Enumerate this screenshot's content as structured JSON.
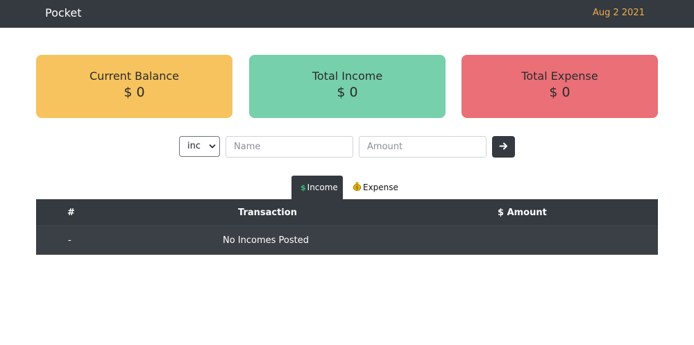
{
  "navbar": {
    "brand": "Pocket",
    "date": "Aug 2 2021",
    "date_color": "#f0ad4e"
  },
  "cards": {
    "balance": {
      "title": "Current Balance",
      "value": "$ 0",
      "color": "#f6c35e"
    },
    "income": {
      "title": "Total Income",
      "value": "$ 0",
      "color": "#76d0ab"
    },
    "expense": {
      "title": "Total Expense",
      "value": "$ 0",
      "color": "#ea6f77"
    }
  },
  "form": {
    "type_select": {
      "selected": "inc"
    },
    "name_placeholder": "Name",
    "amount_placeholder": "Amount",
    "submit_icon": "arrow-right-icon"
  },
  "tabs": [
    {
      "label": "Income",
      "icon": "dollar-icon",
      "active": true
    },
    {
      "label": "Expense",
      "icon": "money-bag-icon",
      "active": false
    }
  ],
  "table": {
    "headers": [
      "#",
      "Transaction",
      "$ Amount"
    ],
    "rows": [
      {
        "num": "-",
        "transaction": "No Incomes Posted",
        "amount": ""
      }
    ]
  }
}
